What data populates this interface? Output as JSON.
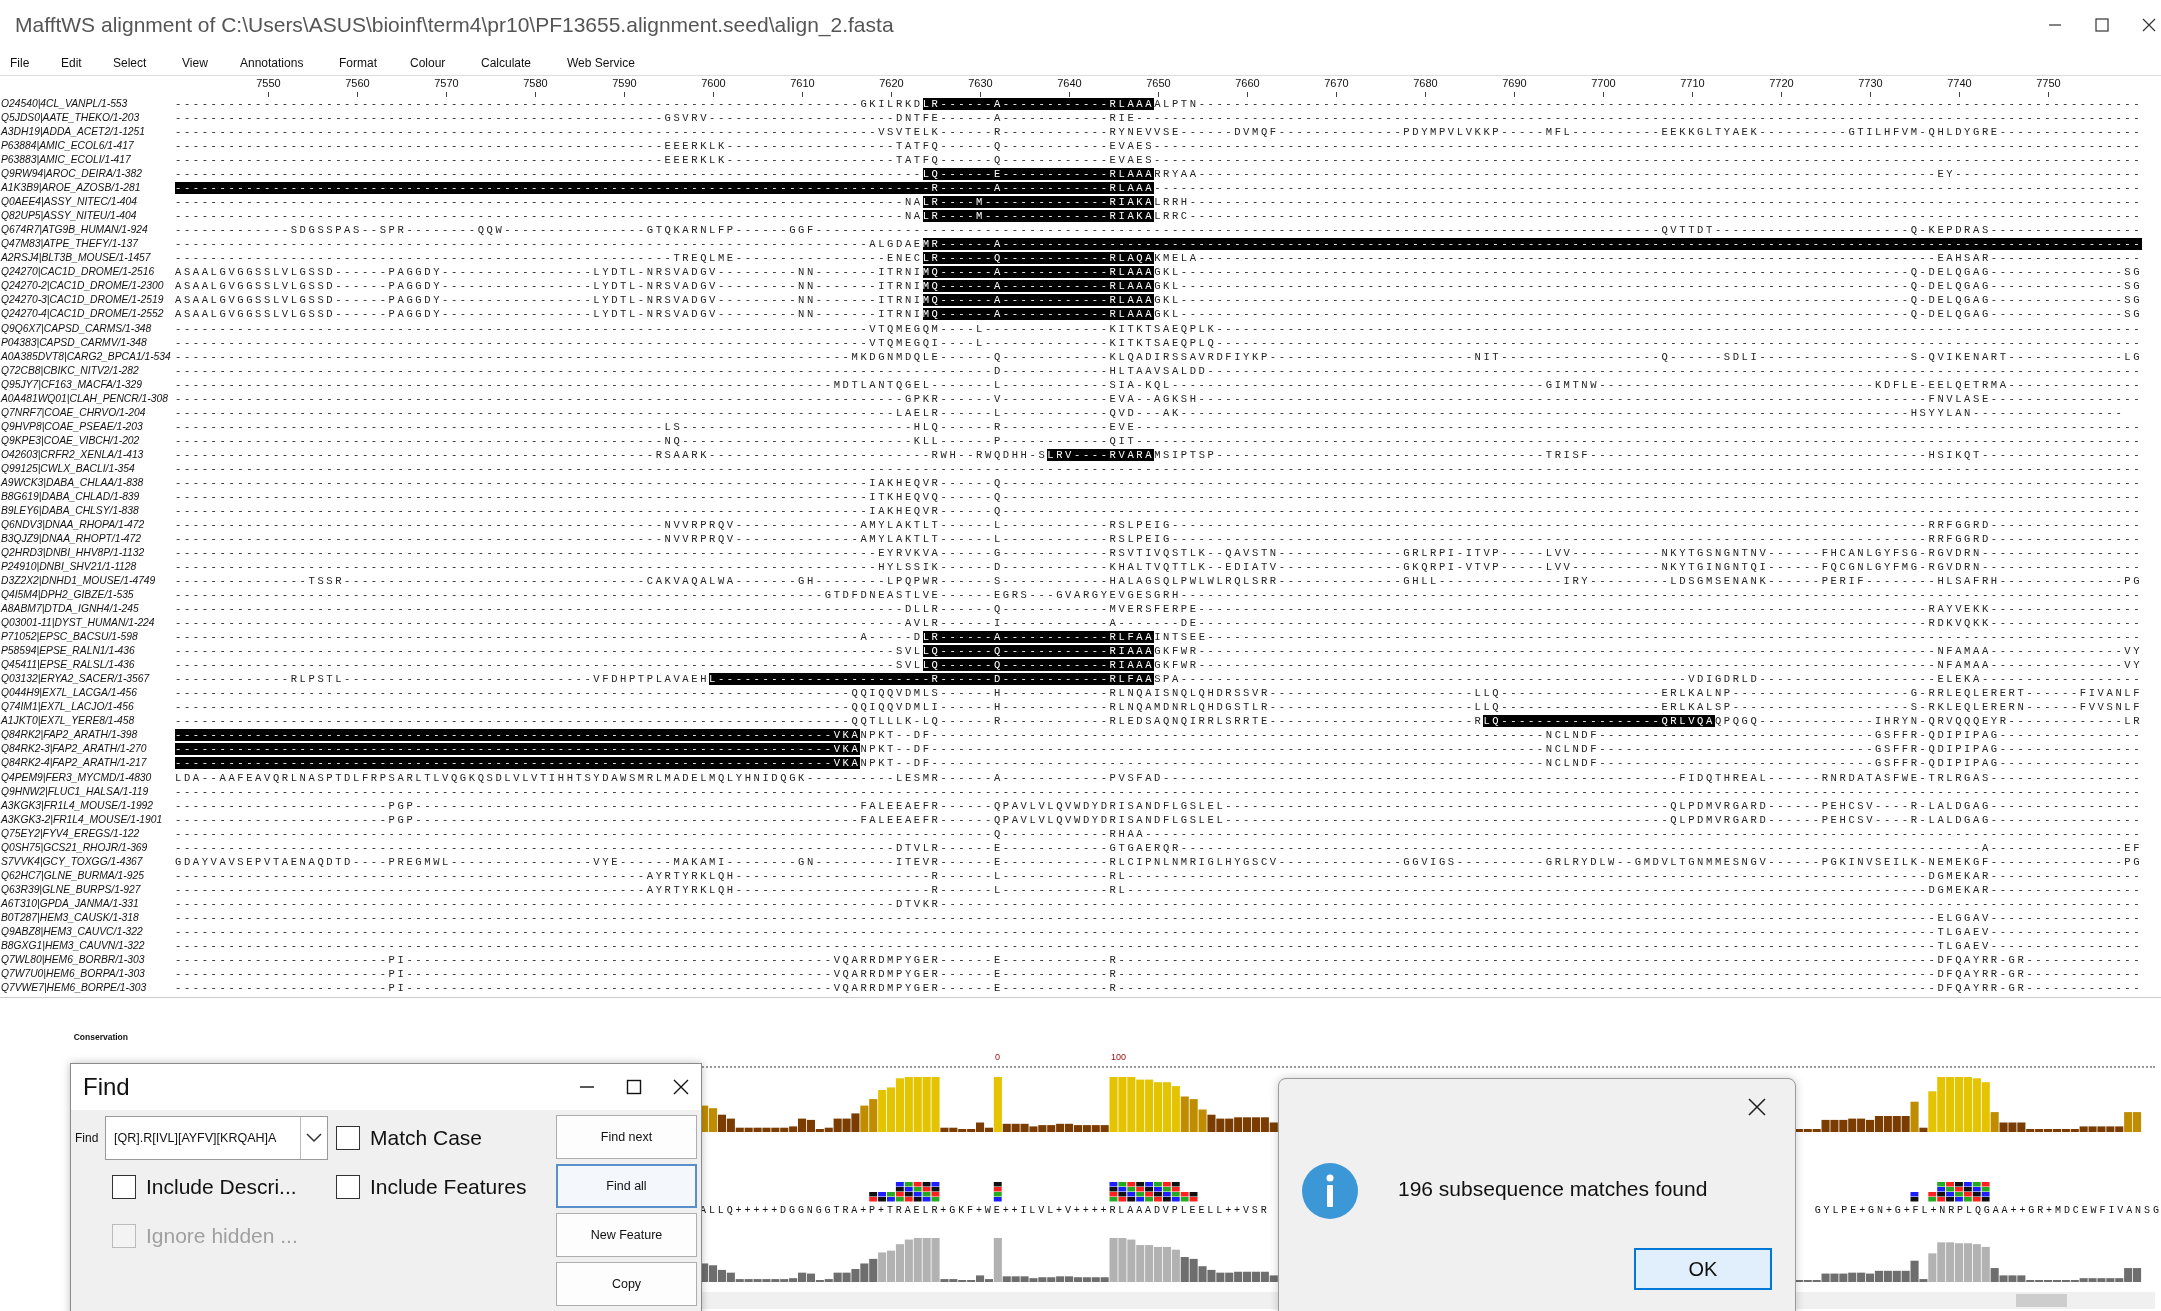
{
  "window": {
    "title": "MafftWS alignment of C:\\Users\\ASUS\\bioinf\\term4\\pr10\\PF13655.alignment.seed\\align_2.fasta"
  },
  "menu": [
    "File",
    "Edit",
    "Select",
    "View",
    "Annotations",
    "Format",
    "Colour",
    "Calculate",
    "Web Service"
  ],
  "ruler": [
    "7550",
    "7560",
    "7570",
    "7580",
    "7590",
    "7600",
    "7610",
    "7620",
    "7630",
    "7640",
    "7650",
    "7660",
    "7670",
    "7680",
    "7690",
    "7700",
    "7710",
    "7720",
    "7730",
    "7740",
    "7750"
  ],
  "alignment": {
    "rows": [
      {
        "name": "O24540|4CL_VANPL/1-553",
        "segments": [
          {
            "text": "-----------------------------------------------------------------------------GKILRKD",
            "highlighted": false
          },
          {
            "text": "LR------A------------RLAAA",
            "highlighted": true
          },
          {
            "text": "ALPTN----------------------------------------------------------------------------------------------------------",
            "highlighted": false
          }
        ]
      },
      {
        "name": "Q5JDS0|AATE_THEKO/1-203",
        "segments": [
          {
            "text": "-------------------------------------------------------GSVRV---------------------DNTFE------A------------RIE-----------------------------------------------------------------------------------------------------------------",
            "highlighted": false
          }
        ]
      },
      {
        "name": "A3DH19|ADDA_ACET2/1-1251",
        "segments": [
          {
            "text": "-------------------------------------------------------------------------------VSVTELK------R------------RYNEVVSE------DVMQF--------------PDYMPVLVKKP-----MFL----------EEKKGLTYAEK----------GTILHFVM-QHLDYGRE----------------",
            "highlighted": false
          }
        ]
      },
      {
        "name": "P63884|AMIC_ECOL6/1-417",
        "segments": [
          {
            "text": "-------------------------------------------------------EEERKLK-------------------TATFQ------Q------------EVAES---------------------------------------------------------------------------------------------------------------",
            "highlighted": false
          }
        ]
      },
      {
        "name": "P63883|AMIC_ECOLI/1-417",
        "segments": [
          {
            "text": "-------------------------------------------------------EEERKLK-------------------TATFQ------Q------------EVAES---------------------------------------------------------------------------------------------------------------",
            "highlighted": false
          }
        ]
      },
      {
        "name": "Q9RW94|AROC_DEIRA/1-382",
        "segments": [
          {
            "text": "------------------------------------------------------------------------------------",
            "highlighted": false
          },
          {
            "text": "LQ------E------------RLAAA",
            "highlighted": true
          },
          {
            "text": "RRYAA-----------------------------------------------------------------------------------EY---------------------",
            "highlighted": false
          }
        ]
      },
      {
        "name": "A1K3B9|AROE_AZOSB/1-281",
        "segments": [
          {
            "text": "-------------------------------------------------------------------------------------R------A------------RLAAA",
            "highlighted": true
          },
          {
            "text": "---------------------------------------------------------------------------------------------------------------",
            "highlighted": false
          }
        ]
      },
      {
        "name": "Q0AEE4|ASSY_NITEC/1-404",
        "segments": [
          {
            "text": "----------------------------------------------------------------------------------NA",
            "highlighted": false
          },
          {
            "text": "LR----M--------------RIAKA",
            "highlighted": true
          },
          {
            "text": "LRRH-----------------------------------------------------------------------------------------------------------",
            "highlighted": false
          }
        ]
      },
      {
        "name": "Q82UP5|ASSY_NITEU/1-404",
        "segments": [
          {
            "text": "----------------------------------------------------------------------------------NA",
            "highlighted": false
          },
          {
            "text": "LR----M--------------RIAKA",
            "highlighted": true
          },
          {
            "text": "LRRC-----------------------------------------------------------------------------------------------------------",
            "highlighted": false
          }
        ]
      },
      {
        "name": "Q674R7|ATG9B_HUMAN/1-924",
        "segments": [
          {
            "text": "-------------SDGSSPAS--SPR--------QQW----------------GTQKARNLFP------GGF-----------------------------------------------------------------------------------------------QVTTDT----------------------Q-KEPDRAS-----------------",
            "highlighted": false
          }
        ]
      },
      {
        "name": "Q47M83|ATPE_THEFY/1-137",
        "segments": [
          {
            "text": "------------------------------------------------------------------------------ALGDAE",
            "highlighted": false
          },
          {
            "text": "MR------A--------------------------------------------------------------------------------------------------------------------------------",
            "highlighted": true
          }
        ]
      },
      {
        "name": "A2RSJ4|BLT3B_MOUSE/1-1457",
        "segments": [
          {
            "text": "--------------------------------------------------------TREQLME-----------------ENEC",
            "highlighted": false
          },
          {
            "text": "LR------Q------------RLAQA",
            "highlighted": true
          },
          {
            "text": "KMELA-----------------------------------------------------------------------------------EAHSAR-----------------",
            "highlighted": false
          }
        ]
      },
      {
        "name": "Q24270|CAC1D_DROME/1-2516",
        "segments": [
          {
            "text": "ASAALGVGGSSLVLGSSD------PAGGDY-----------------LYDTL-NRSVADGV---------NN-------ITRNI",
            "highlighted": false
          },
          {
            "text": "MQ------A------------RLAAA",
            "highlighted": true
          },
          {
            "text": "GKL----------------------------------------------------------------------------------Q-DELQGAG---------------SG",
            "highlighted": false
          }
        ]
      },
      {
        "name": "Q24270-2|CAC1D_DROME/1-2300",
        "segments": [
          {
            "text": "ASAALGVGGSSLVLGSSD------PAGGDY-----------------LYDTL-NRSVADGV---------NN-------ITRNI",
            "highlighted": false
          },
          {
            "text": "MQ------A------------RLAAA",
            "highlighted": true
          },
          {
            "text": "GKL----------------------------------------------------------------------------------Q-DELQGAG---------------SG",
            "highlighted": false
          }
        ]
      },
      {
        "name": "Q24270-3|CAC1D_DROME/1-2519",
        "segments": [
          {
            "text": "ASAALGVGGSSLVLGSSD------PAGGDY-----------------LYDTL-NRSVADGV---------NN-------ITRNI",
            "highlighted": false
          },
          {
            "text": "MQ------A------------RLAAA",
            "highlighted": true
          },
          {
            "text": "GKL----------------------------------------------------------------------------------Q-DELQGAG---------------SG",
            "highlighted": false
          }
        ]
      },
      {
        "name": "Q24270-4|CAC1D_DROME/1-2552",
        "segments": [
          {
            "text": "ASAALGVGGSSLVLGSSD------PAGGDY-----------------LYDTL-NRSVADGV---------NN-------ITRNI",
            "highlighted": false
          },
          {
            "text": "MQ------A------------RLAAA",
            "highlighted": true
          },
          {
            "text": "GKL----------------------------------------------------------------------------------Q-DELQGAG---------------SG",
            "highlighted": false
          }
        ]
      },
      {
        "name": "Q9Q6X7|CAPSD_CARMS/1-348",
        "segments": [
          {
            "text": "------------------------------------------------------------------------------VTQMEGQM----L--------------KITKTSAEQPLK--------------------------------------------------------------------------------------------------------",
            "highlighted": false
          }
        ]
      },
      {
        "name": "P04383|CAPSD_CARMV/1-348",
        "segments": [
          {
            "text": "------------------------------------------------------------------------------VTQMEGQI----L--------------KITKTSAEQPLQ--------------------------------------------------------------------------------------------------------",
            "highlighted": false
          }
        ]
      },
      {
        "name": "A0A385DVT8|CARG2_BPCA1/1-534",
        "segments": [
          {
            "text": "----------------------------------------------------------------------------MKDGNMDQLE------Q------------KLQADIRSSAVRDFIYKP-----------------------NIT------------------Q------SDLI-----------------S-QVIKENART-------------LG",
            "highlighted": false
          }
        ]
      },
      {
        "name": "Q72CB8|CBIKC_NITV2/1-282",
        "segments": [
          {
            "text": "--------------------------------------------------------------------------------------------D------------HLTAAVSALDD---------------------------------------------------------------------------------------------------------",
            "highlighted": false
          }
        ]
      },
      {
        "name": "Q95JY7|CF163_MACFA/1-329",
        "segments": [
          {
            "text": "--------------------------------------------------------------------------MDTLANTQGEL-------L------------SIA-KQL------------------------------------------GIMTNW-------------------------------KDFLE-EELQETRMA---------------",
            "highlighted": false
          }
        ]
      },
      {
        "name": "A0A481WQ01|CLAH_PENCR/1-308",
        "segments": [
          {
            "text": "----------------------------------------------------------------------------------GPKR------V------------EVA--AGKSH----------------------------------------------------------------------------------FNVLASE-----------------",
            "highlighted": false
          }
        ]
      },
      {
        "name": "Q7NRF7|COAE_CHRVO/1-204",
        "segments": [
          {
            "text": "---------------------------------------------------------------------------------LAELR------L------------QVD---AK----------------------------------------------------------------------------------HSYYLAN-----------------",
            "highlighted": false
          }
        ]
      },
      {
        "name": "Q9HVP8|COAE_PSEAE/1-203",
        "segments": [
          {
            "text": "-------------------------------------------------------LS--------------------------HLQ------R------------EVE-----------------------------------------------------------------------------------------------------------------",
            "highlighted": false
          }
        ]
      },
      {
        "name": "Q9KPE3|COAE_VIBCH/1-202",
        "segments": [
          {
            "text": "-------------------------------------------------------NQ--------------------------KLL------P------------QIT-----------------------------------------------------------------------------------------------------------------",
            "highlighted": false
          }
        ]
      },
      {
        "name": "O42603|CRFR2_XENLA/1-413",
        "segments": [
          {
            "text": "------------------------------------------------------RSAARK-------------------------RWH--RWQDHH-S",
            "highlighted": false
          },
          {
            "text": "LRV----RVARA",
            "highlighted": true
          },
          {
            "text": "MSIPTSP-------------------------------------TRISF--------------------------------------HSIKQT------------------",
            "highlighted": false
          }
        ]
      },
      {
        "name": "Q99125|CWLX_BACLI/1-354",
        "segments": [
          {
            "text": "-----------------------------------------------------------------------------------------------------------------------------------------------------------------------------------------------------------------------------",
            "highlighted": false
          }
        ]
      },
      {
        "name": "A9WCK3|DABA_CHLAA/1-838",
        "segments": [
          {
            "text": "------------------------------------------------------------------------------IAKHEQVR------Q--------------------------------------------------------------------------------------------------------------------------------",
            "highlighted": false
          }
        ]
      },
      {
        "name": "B8G619|DABA_CHLAD/1-839",
        "segments": [
          {
            "text": "------------------------------------------------------------------------------ITKHEQVQ------Q--------------------------------------------------------------------------------------------------------------------------------",
            "highlighted": false
          }
        ]
      },
      {
        "name": "B9LEY6|DABA_CHLSY/1-838",
        "segments": [
          {
            "text": "------------------------------------------------------------------------------IAKHEQVR------Q--------------------------------------------------------------------------------------------------------------------------------",
            "highlighted": false
          }
        ]
      },
      {
        "name": "Q6NDV3|DNAA_RHOPA/1-472",
        "segments": [
          {
            "text": "-------------------------------------------------------NVVRPRQV--------------AMYLAKTLT------L------------RSLPEIG-------------------------------------------------------------------------------------RRFGGRD-----------------",
            "highlighted": false
          }
        ]
      },
      {
        "name": "B3QJZ9|DNAA_RHOPT/1-472",
        "segments": [
          {
            "text": "-------------------------------------------------------NVVRPRQV--------------AMYLAKTLT------L------------RSLPEIG-------------------------------------------------------------------------------------RRFGGRD-----------------",
            "highlighted": false
          }
        ]
      },
      {
        "name": "Q2HRD3|DNBI_HHV8P/1-1132",
        "segments": [
          {
            "text": "-------------------------------------------------------------------------------EYRVKVA------G------------RSVTIVQSTLK--QAVSTN--------------GRLRPI-ITVP-----LVV----------NKYTGSNGNTNV------FHCANLGYFSG-RGVDRN------------------",
            "highlighted": false
          }
        ]
      },
      {
        "name": "P24910|DNBI_SHV21/1-1128",
        "segments": [
          {
            "text": "-------------------------------------------------------------------------------HYLSSIK------D------------KHALTVQTTLK--EDIATV--------------GKQRPI-VTVP-----LVV----------NKYTGINGNTQI------FQCGNLGYFMG-RGVDRN------------------",
            "highlighted": false
          }
        ]
      },
      {
        "name": "D3Z2X2|DNHD1_MOUSE/1-4749",
        "segments": [
          {
            "text": "---------------TSSR----------------------------------CAKVAQALWA-------GH--------LPQPWR------S------------HALAGSQLPWLWLRQLSRR--------------GHLL--------------IRY---------LDSGMSENANK------PERIF--------HLSAFRH--------------PG",
            "highlighted": false
          }
        ]
      },
      {
        "name": "Q4I5M4|DPH2_GIBZE/1-535",
        "segments": [
          {
            "text": "-------------------------------------------------------------------------GTDFDNEASTLVE------EGRS---GVARGYEVGESGRH------------------------------------------------------------------------------------------------------------",
            "highlighted": false
          }
        ]
      },
      {
        "name": "A8ABM7|DTDA_IGNH4/1-245",
        "segments": [
          {
            "text": "----------------------------------------------------------------------------------DLLR------Q------------MVERSFERPE----------------------------------------------------------------------------------RAYVEKK-----------------",
            "highlighted": false
          }
        ]
      },
      {
        "name": "Q03001-11|DYST_HUMAN/1-224",
        "segments": [
          {
            "text": "----------------------------------------------------------------------------------AVLR------I------------A-------DE----------------------------------------------------------------------------------RDKVQKK-----------------",
            "highlighted": false
          }
        ]
      },
      {
        "name": "P71052|EPSC_BACSU/1-598",
        "segments": [
          {
            "text": "-----------------------------------------------------------------------------A-----D",
            "highlighted": false
          },
          {
            "text": "LR------A------------RLFAA",
            "highlighted": true
          },
          {
            "text": "INTSEE---------------------------------------------------------------------------------------------------------",
            "highlighted": false
          }
        ]
      },
      {
        "name": "P58594|EPSE_RALN1/1-436",
        "segments": [
          {
            "text": "---------------------------------------------------------------------------------SVL",
            "highlighted": false
          },
          {
            "text": "LQ------Q------------RIAAA",
            "highlighted": true
          },
          {
            "text": "GKFWR-----------------------------------------------------------------------------------NFAMAA---------------VY",
            "highlighted": false
          }
        ]
      },
      {
        "name": "Q45411|EPSE_RALSL/1-436",
        "segments": [
          {
            "text": "---------------------------------------------------------------------------------SVL",
            "highlighted": false
          },
          {
            "text": "LQ------Q------------RIAAA",
            "highlighted": true
          },
          {
            "text": "GKFWR-----------------------------------------------------------------------------------NFAMAA---------------VY",
            "highlighted": false
          }
        ]
      },
      {
        "name": "Q03132|ERYA2_SACER/1-3567",
        "segments": [
          {
            "text": "-------------RLPSTL----------------------------VFDHPTPLAVAEH",
            "highlighted": false
          },
          {
            "text": "L------------------------R------D------------RLFAA",
            "highlighted": true
          },
          {
            "text": "SPA---------------------------------------------------------VDIGDRLD--------------------ELEKA------------------",
            "highlighted": false
          }
        ]
      },
      {
        "name": "Q044H9|EX7L_LACGA/1-456",
        "segments": [
          {
            "text": "----------------------------------------------------------------------------QQIQQVDMLS------H------------RLNQAISNQLQHDRSSVR-----------------------LLQ------------------ERLKALNP--------------------G-RRLEQLERERT------FIVANLF",
            "highlighted": false
          }
        ]
      },
      {
        "name": "Q74IM1|EX7L_LACJO/1-456",
        "segments": [
          {
            "text": "----------------------------------------------------------------------------QQIQQVDMLI------H------------RLNQAMDNRLQHDGSTLR-----------------------LLQ------------------ERLKALSP--------------------S-RKLEQLERERN------FVVSNLF",
            "highlighted": false
          }
        ]
      },
      {
        "name": "A1JKT0|EX7L_YERE8/1-458",
        "segments": [
          {
            "text": "----------------------------------------------------------------------------QQTLLLK-LQ------R------------RLEDSAQNQIRRLSRRTE-----------------------R",
            "highlighted": false
          },
          {
            "text": "LQ------------------QRLVQA",
            "highlighted": true
          },
          {
            "text": "QPQGQ-------------IHRYN-QRVQQQEYR-------------LR",
            "highlighted": false
          }
        ]
      },
      {
        "name": "Q84RK2|FAP2_ARATH/1-398",
        "segments": [
          {
            "text": "--------------------------------------------------------------------------VKA",
            "highlighted": true
          },
          {
            "text": "NPKT--DF---------------------------------------------------------------------NCLNDF-------------------------------GSFFR-QDIPIPAG----------------",
            "highlighted": false
          }
        ]
      },
      {
        "name": "Q84RK2-3|FAP2_ARATH/1-270",
        "segments": [
          {
            "text": "--------------------------------------------------------------------------VKA",
            "highlighted": true
          },
          {
            "text": "NPKT--DF---------------------------------------------------------------------NCLNDF-------------------------------GSFFR-QDIPIPAG----------------",
            "highlighted": false
          }
        ]
      },
      {
        "name": "Q84RK2-4|FAP2_ARATH/1-217",
        "segments": [
          {
            "text": "--------------------------------------------------------------------------VKA",
            "highlighted": true
          },
          {
            "text": "NPKT--DF---------------------------------------------------------------------NCLNDF-------------------------------GSFFR-QDIPIPAG----------------",
            "highlighted": false
          }
        ]
      },
      {
        "name": "Q4PEM9|FER3_MYCMD/1-4830",
        "segments": [
          {
            "text": "LDA--AAFEAVQRLNASPTDLFRPSARLTLVQGKQSDLVLVTIHHTSYDAWSMRLMADELMQLYHNIDQGK----------LESMR------A------------PVSFAD----------------------------------------------------------FIDQTHREAL------RNRDATASFWE-TRLRGAS-----------------",
            "highlighted": false
          }
        ]
      },
      {
        "name": "Q9HNW2|FLUC1_HALSA/1-119",
        "segments": [
          {
            "text": "-----------------------------------------------------------------------------------------------------------------------------------------------------------------------------------------------------------------------------",
            "highlighted": false
          }
        ]
      },
      {
        "name": "A3KGK3|FR1L4_MOUSE/1-1992",
        "segments": [
          {
            "text": "------------------------PGP--------------------------------------------------FALEEAEFR------QPAVLVLQVWDYDRISANDFLGSLEL--------------------------------------------------QLPDMVRGARD------PEHCSV----R-LALDGAG-----------------",
            "highlighted": false
          }
        ]
      },
      {
        "name": "A3KGK3-2|FR1L4_MOUSE/1-1901",
        "segments": [
          {
            "text": "------------------------PGP--------------------------------------------------FALEEAEFR------QPAVLVLQVWDYDRISANDFLGSLEL--------------------------------------------------QLPDMVRGARD------PEHCSV----R-LALDGAG-----------------",
            "highlighted": false
          }
        ]
      },
      {
        "name": "Q75EY2|FYV4_EREGS/1-122",
        "segments": [
          {
            "text": "--------------------------------------------------------------------------------------------Q------------RHAA----------------------------------------------------------------------------------------------------------------",
            "highlighted": false
          }
        ]
      },
      {
        "name": "Q0SH75|GCS21_RHOJR/1-369",
        "segments": [
          {
            "text": "---------------------------------------------------------------------------------DTVLR------E------------GTGAERQR------------------------------------------------------------------------------------------A---------------EF",
            "highlighted": false
          }
        ]
      },
      {
        "name": "S7VVK4|GCY_TOXGG/1-4367",
        "segments": [
          {
            "text": "GDAYVAVSEPVTAENAQDTD----PREGMWL----------------VYE------MAKAMI--------GN---------ITEVR------E------------RLCIPNLNMRIGLHYGSCV--------------GGVIGS----------GRLRYDLW--GMDVLTGNMMESNGV------PGKINVSEILK-NEMEKGF---------------PG",
            "highlighted": false
          }
        ]
      },
      {
        "name": "Q62HC7|GLNE_BURMA/1-925",
        "segments": [
          {
            "text": "-----------------------------------------------------AYRTYRKLQH----------------------R------L------------RL------------------------------------------------------------------------------------------DGMEKAR-----------------",
            "highlighted": false
          }
        ]
      },
      {
        "name": "Q63R39|GLNE_BURPS/1-927",
        "segments": [
          {
            "text": "-----------------------------------------------------AYRTYRKLQH----------------------R------L------------RL------------------------------------------------------------------------------------------DGMEKAR-----------------",
            "highlighted": false
          }
        ]
      },
      {
        "name": "A6T310|GPDA_JANMA/1-331",
        "segments": [
          {
            "text": "---------------------------------------------------------------------------------DTVKR---------------------------------------------------------------------------------------------------------------------------------------",
            "highlighted": false
          }
        ]
      },
      {
        "name": "B0T287|HEM3_CAUSK/1-318",
        "segments": [
          {
            "text": "------------------------------------------------------------------------------------------------------------------------------------------------------------------------------------------------------ELGGAV-----------------",
            "highlighted": false
          }
        ]
      },
      {
        "name": "Q9ABZ8|HEM3_CAUVC/1-322",
        "segments": [
          {
            "text": "------------------------------------------------------------------------------------------------------------------------------------------------------------------------------------------------------TLGAEV-----------------",
            "highlighted": false
          }
        ]
      },
      {
        "name": "B8GXG1|HEM3_CAUVN/1-322",
        "segments": [
          {
            "text": "------------------------------------------------------------------------------------------------------------------------------------------------------------------------------------------------------TLGAEV-----------------",
            "highlighted": false
          }
        ]
      },
      {
        "name": "Q7WL80|HEM6_BORBR/1-303",
        "segments": [
          {
            "text": "------------------------PI------------------------------------------------VQARRDMPYGER------E------------R--------------------------------------------------------------------------------------------DFQAYRR-GR-------------",
            "highlighted": false
          }
        ]
      },
      {
        "name": "Q7W7U0|HEM6_BORPA/1-303",
        "segments": [
          {
            "text": "------------------------PI------------------------------------------------VQARRDMPYGER------E------------R--------------------------------------------------------------------------------------------DFQAYRR-GR-------------",
            "highlighted": false
          }
        ]
      },
      {
        "name": "Q7VWE7|HEM6_BORPE/1-303",
        "segments": [
          {
            "text": "------------------------PI------------------------------------------------VQARRDMPYGER------E------------R--------------------------------------------------------------------------------------------DFQAYRR-GR-------------",
            "highlighted": false
          }
        ]
      }
    ]
  },
  "annotations": {
    "label": "Conservation",
    "marker_labels": [
      "0",
      "100"
    ],
    "consensus": [
      "ALLQ+++++DGGNGGTRA+P+TRAELR+GKF+WE++ILVL+V++++RLAAADVPLEELL++VSR",
      "GYLPE+GN+G+FL+NRPLQGAA++GR+MDCEWFIVANSG"
    ]
  },
  "find_dialog": {
    "title": "Find",
    "find_label": "Find",
    "query": "[QR].R[IVL][AYFV][KRQAH]A",
    "options": [
      {
        "label": "Match Case",
        "checked": false,
        "disabled": false
      },
      {
        "label": "Include Descri...",
        "checked": false,
        "disabled": false
      },
      {
        "label": "Include Features",
        "checked": false,
        "disabled": false
      },
      {
        "label": "Ignore hidden ...",
        "checked": false,
        "disabled": true
      }
    ],
    "buttons": [
      {
        "label": "Find next",
        "focused": false
      },
      {
        "label": "Find all",
        "focused": true
      },
      {
        "label": "New Feature",
        "focused": false
      },
      {
        "label": "Copy",
        "focused": false
      }
    ]
  },
  "message_dialog": {
    "message": "196 subsequence matches found",
    "button": "OK"
  }
}
